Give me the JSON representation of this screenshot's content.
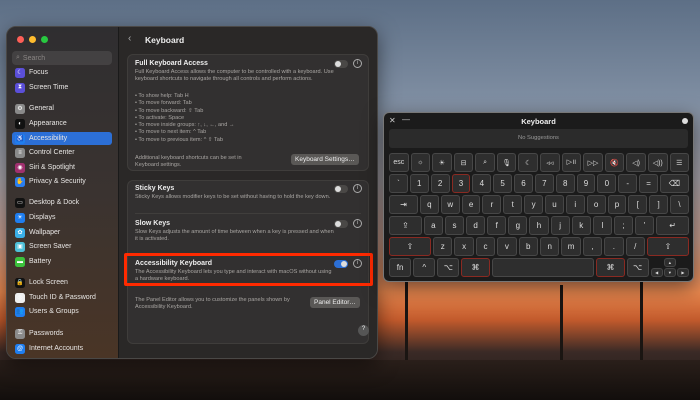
{
  "sidebar": {
    "search_placeholder": "Search",
    "items": [
      {
        "label": "Focus",
        "icon": "moon-icon",
        "color": "#5b4fd8",
        "glyph": "☾"
      },
      {
        "label": "Screen Time",
        "icon": "hourglass-icon",
        "color": "#5b4fd8",
        "glyph": "⧗"
      },
      {
        "label": "General",
        "icon": "gear-icon",
        "color": "#8a8a8a",
        "glyph": "⚙"
      },
      {
        "label": "Appearance",
        "icon": "appearance-icon",
        "color": "#111",
        "glyph": "◐"
      },
      {
        "label": "Accessibility",
        "icon": "accessibility-icon",
        "color": "#1f7ef0",
        "glyph": "♿"
      },
      {
        "label": "Control Center",
        "icon": "control-center-icon",
        "color": "#8a8a8a",
        "glyph": "≡"
      },
      {
        "label": "Siri & Spotlight",
        "icon": "siri-icon",
        "color": "#a0306e",
        "glyph": "◉"
      },
      {
        "label": "Privacy & Security",
        "icon": "hand-icon",
        "color": "#2a7ef0",
        "glyph": "✋"
      },
      {
        "label": "Desktop & Dock",
        "icon": "dock-icon",
        "color": "#111",
        "glyph": "▭"
      },
      {
        "label": "Displays",
        "icon": "sun-icon",
        "color": "#1f7ef0",
        "glyph": "☀"
      },
      {
        "label": "Wallpaper",
        "icon": "flower-icon",
        "color": "#3ab0e8",
        "glyph": "✿"
      },
      {
        "label": "Screen Saver",
        "icon": "screensaver-icon",
        "color": "#4ec0d8",
        "glyph": "▣"
      },
      {
        "label": "Battery",
        "icon": "battery-icon",
        "color": "#3cc23c",
        "glyph": "▬"
      },
      {
        "label": "Lock Screen",
        "icon": "lock-icon",
        "color": "#111",
        "glyph": "🔒"
      },
      {
        "label": "Touch ID & Password",
        "icon": "fingerprint-icon",
        "color": "#eee",
        "glyph": "◎"
      },
      {
        "label": "Users & Groups",
        "icon": "users-icon",
        "color": "#1f7ef0",
        "glyph": "👥"
      },
      {
        "label": "Passwords",
        "icon": "key-icon",
        "color": "#8a8a8a",
        "glyph": "⚿"
      },
      {
        "label": "Internet Accounts",
        "icon": "at-icon",
        "color": "#1f7ef0",
        "glyph": "@"
      }
    ],
    "active": "Accessibility"
  },
  "main": {
    "title": "Keyboard",
    "fka": {
      "title": "Full Keyboard Access",
      "desc": "Full Keyboard Access allows the computer to be controlled with a keyboard. Use keyboard shortcuts to navigate through all controls and perform actions.",
      "shortcuts": [
        "• To show help: Tab H",
        "• To move forward: Tab",
        "• To move backward: ⇧ Tab",
        "• To activate: Space",
        "• To move inside groups: ↑, ↓, ←, and →",
        "• To move to next item: ^ Tab",
        "• To move to previous item: ^ ⇧ Tab"
      ],
      "note": "Additional keyboard shortcuts can be set in Keyboard settings.",
      "button": "Keyboard Settings…",
      "enabled": false
    },
    "sticky": {
      "title": "Sticky Keys",
      "desc": "Sticky Keys allows modifier keys to be set without having to hold the key down.",
      "enabled": false
    },
    "slow": {
      "title": "Slow Keys",
      "desc": "Slow Keys adjusts the amount of time between when a key is pressed and when it is activated.",
      "enabled": false
    },
    "ak": {
      "title": "Accessibility Keyboard",
      "desc": "The Accessibility Keyboard lets you type and interact with macOS without using a hardware keyboard.",
      "enabled": true
    },
    "panel": {
      "note": "The Panel Editor allows you to customize the panels shown by Accessibility Keyboard.",
      "button": "Panel Editor…"
    },
    "help": "?",
    "info": "i"
  },
  "keyboard": {
    "title": "Keyboard",
    "suggestions": "No Suggestions",
    "close": "✕",
    "minimize": "—",
    "rows": [
      [
        [
          "esc",
          1
        ],
        [
          "☼",
          1
        ],
        [
          "☀",
          1
        ],
        [
          "⊟",
          1
        ],
        [
          "⌕",
          1
        ],
        [
          "🎙",
          1
        ],
        [
          "☾",
          1
        ],
        [
          "◃◃",
          1
        ],
        [
          "▷॥",
          1
        ],
        [
          "▷▷",
          1
        ],
        [
          "🔇",
          1
        ],
        [
          "◁)",
          1
        ],
        [
          "◁))",
          1
        ],
        [
          "☰",
          1
        ]
      ],
      [
        [
          "`",
          1
        ],
        [
          "1",
          1
        ],
        [
          "2",
          1
        ],
        [
          "3",
          1,
          1
        ],
        [
          "4",
          1
        ],
        [
          "5",
          1
        ],
        [
          "6",
          1
        ],
        [
          "7",
          1
        ],
        [
          "8",
          1
        ],
        [
          "9",
          1
        ],
        [
          "0",
          1
        ],
        [
          "-",
          1
        ],
        [
          "=",
          1
        ],
        [
          "⌫",
          1.6
        ]
      ],
      [
        [
          "⇥",
          1.6
        ],
        [
          "q",
          1
        ],
        [
          "w",
          1
        ],
        [
          "e",
          1
        ],
        [
          "r",
          1
        ],
        [
          "t",
          1
        ],
        [
          "y",
          1
        ],
        [
          "u",
          1
        ],
        [
          "i",
          1
        ],
        [
          "o",
          1
        ],
        [
          "p",
          1
        ],
        [
          "[",
          1
        ],
        [
          "]",
          1
        ],
        [
          "\\",
          1
        ]
      ],
      [
        [
          "⇪",
          1.8
        ],
        [
          "a",
          1
        ],
        [
          "s",
          1
        ],
        [
          "d",
          1
        ],
        [
          "f",
          1
        ],
        [
          "g",
          1
        ],
        [
          "h",
          1
        ],
        [
          "j",
          1
        ],
        [
          "k",
          1
        ],
        [
          "l",
          1
        ],
        [
          ";",
          1
        ],
        [
          "'",
          1
        ],
        [
          "↵",
          1.8
        ]
      ],
      [
        [
          "⇧",
          2.3,
          1
        ],
        [
          "z",
          1
        ],
        [
          "x",
          1
        ],
        [
          "c",
          1
        ],
        [
          "v",
          1
        ],
        [
          "b",
          1
        ],
        [
          "n",
          1
        ],
        [
          "m",
          1
        ],
        [
          ",",
          1
        ],
        [
          ".",
          1
        ],
        [
          "/",
          1
        ],
        [
          "⇧",
          2.3,
          1
        ]
      ],
      [
        [
          "fn",
          1
        ],
        [
          "^",
          1
        ],
        [
          "⌥",
          1
        ],
        [
          "⌘",
          1.3,
          1
        ],
        [
          " ",
          5
        ],
        [
          "⌘",
          1.3,
          1
        ],
        [
          "⌥",
          1
        ]
      ]
    ],
    "arrows": [
      "▲",
      "◀",
      "▼",
      "▶"
    ]
  }
}
